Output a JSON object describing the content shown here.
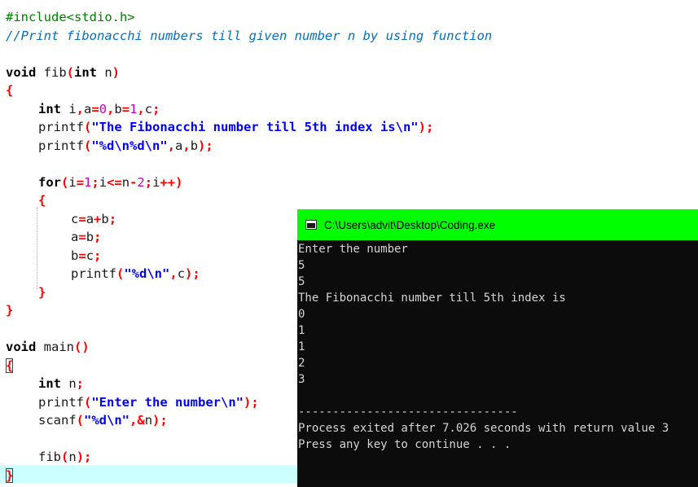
{
  "editor": {
    "lines": [
      {
        "indent": 0,
        "tokens": [
          {
            "t": "#include<stdio.h>",
            "c": "pre"
          }
        ]
      },
      {
        "indent": 0,
        "tokens": [
          {
            "t": "//Print fibonacchi numbers till given number n by using function",
            "c": "cmt"
          }
        ]
      },
      {
        "indent": 0,
        "tokens": []
      },
      {
        "indent": 0,
        "tokens": [
          {
            "t": "void",
            "c": "kw"
          },
          {
            "t": " fib",
            "c": "id"
          },
          {
            "t": "(",
            "c": "sym"
          },
          {
            "t": "int",
            "c": "kw"
          },
          {
            "t": " n",
            "c": "id"
          },
          {
            "t": ")",
            "c": "sym"
          }
        ]
      },
      {
        "indent": 0,
        "tokens": [
          {
            "t": "{",
            "c": "sym"
          }
        ]
      },
      {
        "indent": 40,
        "tokens": [
          {
            "t": "int",
            "c": "kw"
          },
          {
            "t": " i",
            "c": "id"
          },
          {
            "t": ",",
            "c": "sym"
          },
          {
            "t": "a",
            "c": "id"
          },
          {
            "t": "=",
            "c": "sym"
          },
          {
            "t": "0",
            "c": "num"
          },
          {
            "t": ",",
            "c": "sym"
          },
          {
            "t": "b",
            "c": "id"
          },
          {
            "t": "=",
            "c": "sym"
          },
          {
            "t": "1",
            "c": "num"
          },
          {
            "t": ",",
            "c": "sym"
          },
          {
            "t": "c",
            "c": "id"
          },
          {
            "t": ";",
            "c": "sym"
          }
        ]
      },
      {
        "indent": 40,
        "tokens": [
          {
            "t": "printf",
            "c": "id"
          },
          {
            "t": "(",
            "c": "sym"
          },
          {
            "t": "\"The Fibonacchi number till 5th index is\\n\"",
            "c": "str"
          },
          {
            "t": ");",
            "c": "sym"
          }
        ]
      },
      {
        "indent": 40,
        "tokens": [
          {
            "t": "printf",
            "c": "id"
          },
          {
            "t": "(",
            "c": "sym"
          },
          {
            "t": "\"%d\\n%d\\n\"",
            "c": "str"
          },
          {
            "t": ",",
            "c": "sym"
          },
          {
            "t": "a",
            "c": "id"
          },
          {
            "t": ",",
            "c": "sym"
          },
          {
            "t": "b",
            "c": "id"
          },
          {
            "t": ");",
            "c": "sym"
          }
        ]
      },
      {
        "indent": 0,
        "tokens": []
      },
      {
        "indent": 40,
        "tokens": [
          {
            "t": "for",
            "c": "kw"
          },
          {
            "t": "(",
            "c": "sym"
          },
          {
            "t": "i",
            "c": "id"
          },
          {
            "t": "=",
            "c": "sym"
          },
          {
            "t": "1",
            "c": "num"
          },
          {
            "t": ";",
            "c": "sym"
          },
          {
            "t": "i",
            "c": "id"
          },
          {
            "t": "<=",
            "c": "sym"
          },
          {
            "t": "n",
            "c": "id"
          },
          {
            "t": "-",
            "c": "sym"
          },
          {
            "t": "2",
            "c": "num"
          },
          {
            "t": ";",
            "c": "sym"
          },
          {
            "t": "i",
            "c": "id"
          },
          {
            "t": "++",
            "c": "sym"
          },
          {
            "t": ")",
            "c": "sym"
          }
        ]
      },
      {
        "indent": 40,
        "tokens": [
          {
            "t": "{",
            "c": "sym"
          }
        ]
      },
      {
        "indent": 80,
        "tokens": [
          {
            "t": "c",
            "c": "id"
          },
          {
            "t": "=",
            "c": "sym"
          },
          {
            "t": "a",
            "c": "id"
          },
          {
            "t": "+",
            "c": "sym"
          },
          {
            "t": "b",
            "c": "id"
          },
          {
            "t": ";",
            "c": "sym"
          }
        ]
      },
      {
        "indent": 80,
        "tokens": [
          {
            "t": "a",
            "c": "id"
          },
          {
            "t": "=",
            "c": "sym"
          },
          {
            "t": "b",
            "c": "id"
          },
          {
            "t": ";",
            "c": "sym"
          }
        ]
      },
      {
        "indent": 80,
        "tokens": [
          {
            "t": "b",
            "c": "id"
          },
          {
            "t": "=",
            "c": "sym"
          },
          {
            "t": "c",
            "c": "id"
          },
          {
            "t": ";",
            "c": "sym"
          }
        ]
      },
      {
        "indent": 80,
        "tokens": [
          {
            "t": "printf",
            "c": "id"
          },
          {
            "t": "(",
            "c": "sym"
          },
          {
            "t": "\"%d\\n\"",
            "c": "str"
          },
          {
            "t": ",",
            "c": "sym"
          },
          {
            "t": "c",
            "c": "id"
          },
          {
            "t": ");",
            "c": "sym"
          }
        ]
      },
      {
        "indent": 40,
        "tokens": [
          {
            "t": "}",
            "c": "sym"
          }
        ]
      },
      {
        "indent": 0,
        "tokens": [
          {
            "t": "}",
            "c": "sym"
          }
        ]
      },
      {
        "indent": 0,
        "tokens": []
      },
      {
        "indent": 0,
        "tokens": [
          {
            "t": "void",
            "c": "kw"
          },
          {
            "t": " main",
            "c": "id"
          },
          {
            "t": "()",
            "c": "sym"
          }
        ]
      },
      {
        "indent": 0,
        "tokens": [
          {
            "t": "{",
            "c": "brace"
          }
        ]
      },
      {
        "indent": 40,
        "tokens": [
          {
            "t": "int",
            "c": "kw"
          },
          {
            "t": " n",
            "c": "id"
          },
          {
            "t": ";",
            "c": "sym"
          }
        ]
      },
      {
        "indent": 40,
        "tokens": [
          {
            "t": "printf",
            "c": "id"
          },
          {
            "t": "(",
            "c": "sym"
          },
          {
            "t": "\"Enter the number\\n\"",
            "c": "str"
          },
          {
            "t": ");",
            "c": "sym"
          }
        ]
      },
      {
        "indent": 40,
        "tokens": [
          {
            "t": "scanf",
            "c": "id"
          },
          {
            "t": "(",
            "c": "sym"
          },
          {
            "t": "\"%d\\n\"",
            "c": "str"
          },
          {
            "t": ",&",
            "c": "sym"
          },
          {
            "t": "n",
            "c": "id"
          },
          {
            "t": ");",
            "c": "sym"
          }
        ]
      },
      {
        "indent": 0,
        "tokens": []
      },
      {
        "indent": 40,
        "tokens": [
          {
            "t": "fib",
            "c": "id"
          },
          {
            "t": "(",
            "c": "sym"
          },
          {
            "t": "n",
            "c": "id"
          },
          {
            "t": ");",
            "c": "sym"
          }
        ]
      },
      {
        "indent": 0,
        "tokens": [
          {
            "t": "}",
            "c": "brace"
          }
        ]
      }
    ]
  },
  "console": {
    "title": "C:\\Users\\advit\\Desktop\\Coding.exe",
    "icon": "console-window-icon",
    "title_bar_color": "#00ff00",
    "background_color": "#0c0c0c",
    "lines": [
      "Enter the number",
      "5",
      "5",
      "The Fibonacchi number till 5th index is",
      "0",
      "1",
      "1",
      "2",
      "3",
      "",
      "--------------------------------",
      "Process exited after 7.026 seconds with return value 3",
      "Press any key to continue . . ."
    ]
  }
}
